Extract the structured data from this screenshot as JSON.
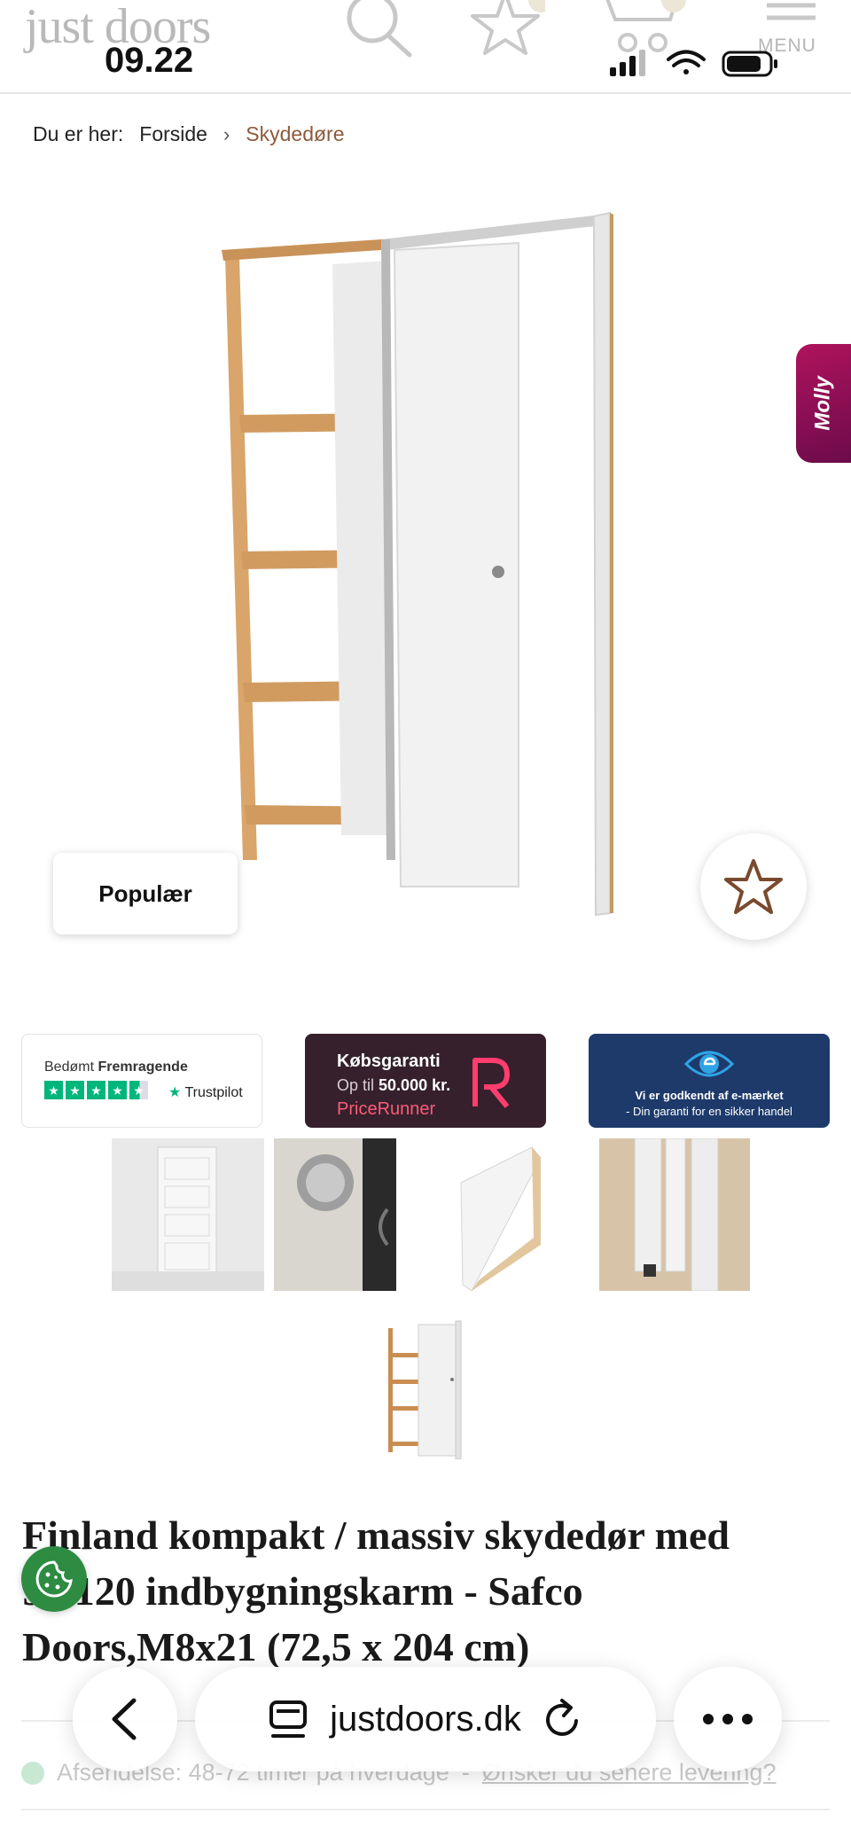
{
  "header": {
    "logo_text": "just doors",
    "clock": "09.22",
    "menu_label": "MENU",
    "icons": [
      "search-icon",
      "star-icon",
      "cart-icon",
      "hamburger-icon"
    ],
    "status_icons": [
      "signal-icon",
      "wifi-icon",
      "battery-icon"
    ]
  },
  "breadcrumb": {
    "prefix": "Du er her:",
    "items": [
      "Forside",
      "Skydedøre"
    ],
    "separator": "›"
  },
  "product": {
    "badge": "Populær",
    "title": "Finland kompakt / massiv skydedør med 95/120 indbygningskarm - Safco Doors,M8x21 (72,5 x 204 cm)",
    "delivery_label": "Afsendelse: 48-72 timer på hverdage",
    "delivery_link": "Ønsker du senere levering?",
    "delivery_separator": "-"
  },
  "chat_widget": {
    "label": "Molly"
  },
  "trust_badges": {
    "trustpilot": {
      "rated": "Bedømt",
      "rating": "Fremragende",
      "brand": "Trustpilot",
      "stars": 4.5
    },
    "pricerunner": {
      "title": "Købsgaranti",
      "sub_prefix": "Op til",
      "sub_amount": "50.000 kr.",
      "brand": "PriceRunner"
    },
    "emaerket": {
      "line1": "Vi er godkendt af e-mærket",
      "line2": "- Din garanti for en sikker handel"
    }
  },
  "thumbnails": [
    "door-white-thumbnail",
    "handle-thumbnail",
    "door-edge-thumbnail",
    "rail-thumbnail",
    "frame-thumbnail"
  ],
  "browser": {
    "url": "justdoors.dk"
  },
  "colors": {
    "accent_brown": "#8c5a3c",
    "trustpilot_green": "#00b67a",
    "pricerunner_bg": "#35202b",
    "emaerket_bg": "#1d3a6b",
    "molly_purple": "#a0125a",
    "cookie_green": "#2e8b42"
  }
}
